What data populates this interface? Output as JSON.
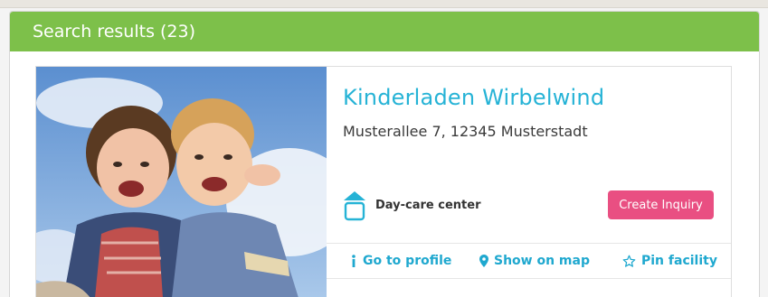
{
  "panel": {
    "header": "Search results (23)"
  },
  "result": {
    "name": "Kinderladen Wirbelwind",
    "address": "Musterallee 7, 12345 Musterstadt",
    "type_label": "Day-care center",
    "type_icon": "day-care-house-icon",
    "inquiry_label": "Create Inquiry",
    "actions": [
      {
        "label": "Go to profile",
        "icon": "info-icon"
      },
      {
        "label": "Show on map",
        "icon": "map-pin-icon"
      },
      {
        "label": "Pin facility",
        "icon": "star-icon"
      }
    ]
  },
  "colors": {
    "header_green": "#7dc04a",
    "accent_cyan": "#26b3d6",
    "button_pink": "#e94f82"
  }
}
